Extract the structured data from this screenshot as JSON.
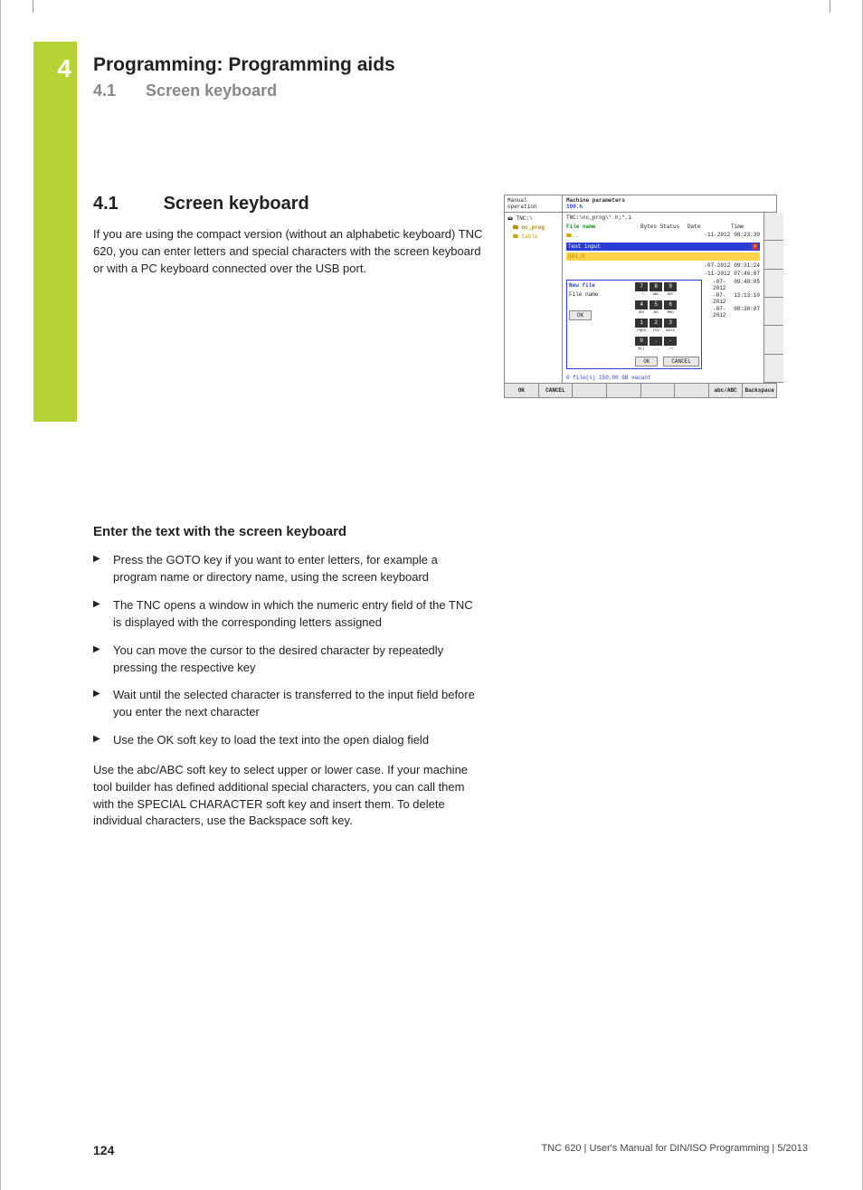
{
  "page": {
    "number": "124",
    "footer_ref": "TNC 620 | User's Manual for DIN/ISO Programming | 5/2013"
  },
  "chapter": {
    "tab_number": "4",
    "title": "Programming: Programming aids",
    "section_number": "4.1",
    "section_name": "Screen keyboard"
  },
  "body": {
    "heading_number": "4.1",
    "heading_text": "Screen keyboard",
    "intro": "If you are using the compact version (without an alphabetic keyboard) TNC 620, you can enter letters and special characters with the screen keyboard or with a PC keyboard connected over the USB port.",
    "subhead": "Enter the text with the screen keyboard",
    "steps": [
      "Press the GOTO key if you want to enter letters, for example a program name or directory name, using the screen keyboard",
      "The TNC opens a window in which the numeric entry field of the TNC is displayed with the corresponding letters assigned",
      "You can move the cursor to the desired character by repeatedly pressing the respective key",
      "Wait until the selected character is transferred to the input field before you enter the next character",
      "Use the OK soft key to load the text into the open dialog field"
    ],
    "para2": "Use the abc/ABC soft key to select upper or lower case. If your machine tool builder has defined additional special characters, you can call them with the SPECIAL CHARACTER soft key and insert them. To delete individual characters, use the Backspace soft key."
  },
  "figure": {
    "mode": "Manual operation",
    "title1": "Machine parameters",
    "title2": "100.h",
    "path": "TNC:\\nc_prog\\*.h;*.i",
    "tree": {
      "root": "TNC:\\",
      "prog": "nc_prog",
      "table": "table"
    },
    "cols": [
      "File name",
      "Bytes Status",
      "Date",
      "Time"
    ],
    "row_up": "..",
    "row_blue": "Text input",
    "rows_right": [
      {
        "date": "-11-2012",
        "time": "08:23:30"
      },
      {
        "date": "-07-2012",
        "time": "09:31:24"
      },
      {
        "date": "-11-2012",
        "time": "07:46:07"
      },
      {
        "date": "-07-2012",
        "time": "09:48:05"
      },
      {
        "date": "-07-2012",
        "time": "13:13:10"
      },
      {
        "date": "-07-2012",
        "time": "08:30:07"
      }
    ],
    "row_yellow": "081.H",
    "dialog": {
      "title": "New file",
      "label": "File name",
      "ok": "OK"
    },
    "keypad": {
      "nums": [
        "7",
        "8",
        "9",
        "4",
        "5",
        "6",
        "1",
        "2",
        "3",
        "0",
        ".",
        "-"
      ],
      "subs": [
        ".?",
        "ABC",
        "DEF",
        "GHI",
        "JKL",
        "MNO",
        "PQRS",
        "TUV",
        "WXYZ",
        "@()",
        ".,;",
        "-+="
      ],
      "btn_ok": "OK",
      "btn_cancel": "CANCEL"
    },
    "status": "0   file(s) 150.00 GB vacant",
    "softkeys": {
      "sk1": "OK",
      "sk2": "CANCEL",
      "sk7": "abc/ABC",
      "sk8": "Backspace"
    }
  }
}
